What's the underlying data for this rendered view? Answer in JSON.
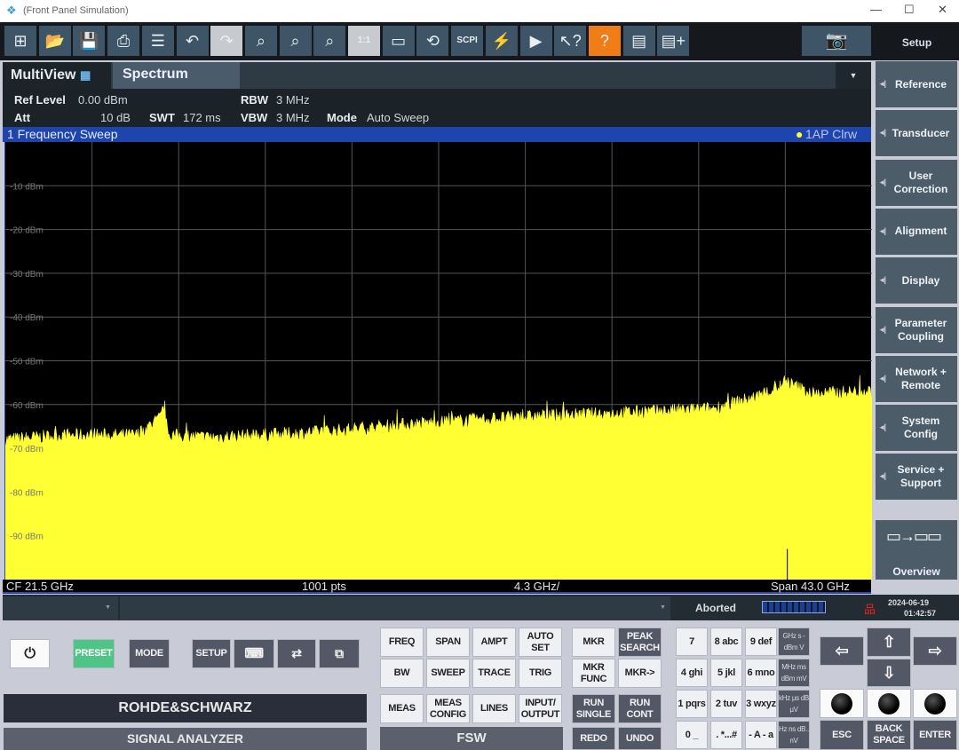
{
  "window": {
    "title": "(Front Panel Simulation)",
    "logo_icon": "diamond-icon",
    "minimize": "—",
    "maximize": "☐",
    "close": "✕"
  },
  "toolbar": {
    "buttons": [
      {
        "name": "windows-icon",
        "glyph": "⊞"
      },
      {
        "name": "open-folder-icon",
        "glyph": "📂"
      },
      {
        "name": "save-icon",
        "glyph": "💾"
      },
      {
        "name": "print-icon",
        "glyph": "⎙"
      },
      {
        "name": "report-icon",
        "glyph": "☰"
      },
      {
        "name": "undo-icon",
        "glyph": "↶"
      },
      {
        "name": "redo-icon",
        "glyph": "↷",
        "disabled": true
      },
      {
        "name": "zoom-icon",
        "glyph": "⌕"
      },
      {
        "name": "multi-zoom-icon",
        "glyph": "⌕"
      },
      {
        "name": "zoom-stack-icon",
        "glyph": "⌕"
      },
      {
        "name": "zoom-off-icon",
        "glyph": "1:1",
        "disabled": true
      },
      {
        "name": "full-screen-icon",
        "glyph": "▭"
      },
      {
        "name": "refresh-icon",
        "glyph": "⟲"
      },
      {
        "name": "scpi-icon",
        "glyph": "SCPI"
      },
      {
        "name": "sequencer-icon",
        "glyph": "⚡"
      },
      {
        "name": "screen-play-icon",
        "glyph": "▶"
      },
      {
        "name": "context-help-icon",
        "glyph": "↖?"
      },
      {
        "name": "help-icon",
        "glyph": "?",
        "help": true
      },
      {
        "name": "remove-window-icon",
        "glyph": "▤"
      },
      {
        "name": "add-window-icon",
        "glyph": "▤+"
      }
    ],
    "screenshot_icon": "camera-icon",
    "setup_label": "Setup"
  },
  "tabs": {
    "multiview": "MultiView",
    "multiview_icon": "grid-icon",
    "spectrum": "Spectrum",
    "dropdown": "▼"
  },
  "info": {
    "ref_level_label": "Ref Level",
    "ref_level": "0.00 dBm",
    "att_label": "Att",
    "att": "10 dB",
    "swt_label": "SWT",
    "swt": "172 ms",
    "rbw_label": "RBW",
    "rbw": "3 MHz",
    "vbw_label": "VBW",
    "vbw": "3 MHz",
    "mode_label": "Mode",
    "mode": "Auto Sweep"
  },
  "window1": {
    "title": "1 Frequency Sweep",
    "trace_label": "1AP Clrw",
    "trace_color": "#ffff33"
  },
  "chart_data": {
    "type": "area",
    "ylim": [
      -100,
      0
    ],
    "xlim_ghz": [
      0,
      43
    ],
    "y_ticks": [
      "-10 dBm",
      "-20 dBm",
      "-30 dBm",
      "-40 dBm",
      "-50 dBm",
      "-60 dBm",
      "-70 dBm",
      "-80 dBm",
      "-90 dBm"
    ],
    "trace_envelope": {
      "x_ghz": [
        0,
        3,
        6.5,
        7.7,
        7.9,
        8.05,
        10,
        15,
        20,
        25,
        30,
        35,
        37.5,
        38.8,
        40,
        43
      ],
      "y_dbm": [
        -68,
        -67,
        -67,
        -63,
        -60,
        -67,
        -67.5,
        -66.5,
        -64.5,
        -63,
        -62,
        -61,
        -58,
        -55,
        -57.5,
        -57
      ]
    },
    "grid": true
  },
  "footer": {
    "cf": "CF 21.5 GHz",
    "pts": "1001 pts",
    "div": "4.3 GHz/",
    "span": "Span 43.0 GHz"
  },
  "status": {
    "dd": "▼",
    "state": "Aborted",
    "date": "2024-06-19",
    "time": "01:42:57",
    "network_icon": "network-icon"
  },
  "right_panel": [
    {
      "label": "Reference"
    },
    {
      "label": "Transducer"
    },
    {
      "label": "User Correction"
    },
    {
      "label": "Alignment"
    },
    {
      "label": "Display"
    },
    {
      "label": "Parameter Coupling"
    },
    {
      "label": "Network + Remote"
    },
    {
      "label": "System Config"
    },
    {
      "label": "Service + Support"
    }
  ],
  "overview": "Overview",
  "front_panel": {
    "power": "⏻",
    "preset": "PRESET",
    "mode": "MODE",
    "setup": "SETUP",
    "brand": "ROHDE&SCHWARZ",
    "product": "SIGNAL ANALYZER",
    "model": "FSW",
    "func_keys": [
      "FREQ",
      "SPAN",
      "AMPT",
      "AUTO SET",
      "BW",
      "SWEEP",
      "TRACE",
      "TRIG",
      "MEAS",
      "MEAS CONFIG",
      "LINES",
      "INPUT/ OUTPUT"
    ],
    "mkr_keys": [
      "MKR",
      "PEAK SEARCH",
      "MKR FUNC",
      "MKR->",
      "RUN SINGLE",
      "RUN CONT",
      "REDO",
      "UNDO"
    ],
    "num_keys": [
      "7",
      "8 abc",
      "9 def",
      "4 ghi",
      "5 jkl",
      "6 mno",
      "1 pqrs",
      "2 tuv",
      "3 wxyz",
      "0 _",
      ". *...#",
      "- A - a"
    ],
    "unit_keys": [
      "GHz s -dBm V",
      "MHz ms dBm mV",
      "kHz µs dB µV",
      "Hz ns dB.. nV"
    ],
    "nav": {
      "left": "⇦",
      "up": "⇧",
      "right": "⇨",
      "down": "⇩",
      "esc": "ESC",
      "backspace": "BACK SPACE",
      "enter": "ENTER"
    }
  }
}
